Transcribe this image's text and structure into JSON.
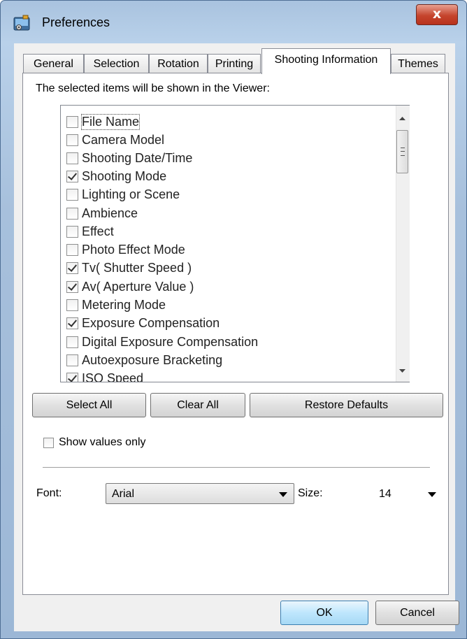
{
  "window": {
    "title": "Preferences",
    "close_glyph": "x",
    "app_icon": "preferences-app-icon",
    "close_icon": "close-icon"
  },
  "tabs": [
    {
      "label": "General"
    },
    {
      "label": "Selection"
    },
    {
      "label": "Rotation"
    },
    {
      "label": "Printing"
    },
    {
      "label": "Shooting Information",
      "active": true
    },
    {
      "label": "Themes"
    }
  ],
  "panel": {
    "instruction": "The selected items will be shown in the Viewer:",
    "items": [
      {
        "label": "File Name",
        "checked": false
      },
      {
        "label": "Camera Model",
        "checked": false
      },
      {
        "label": "Shooting Date/Time",
        "checked": false
      },
      {
        "label": "Shooting Mode",
        "checked": true
      },
      {
        "label": "Lighting or Scene",
        "checked": false
      },
      {
        "label": "Ambience",
        "checked": false
      },
      {
        "label": "Effect",
        "checked": false
      },
      {
        "label": "Photo Effect Mode",
        "checked": false
      },
      {
        "label": "Tv( Shutter Speed )",
        "checked": true
      },
      {
        "label": "Av( Aperture Value )",
        "checked": true
      },
      {
        "label": "Metering Mode",
        "checked": false
      },
      {
        "label": "Exposure Compensation",
        "checked": true
      },
      {
        "label": "Digital Exposure Compensation",
        "checked": false
      },
      {
        "label": "Autoexposure Bracketing",
        "checked": false
      },
      {
        "label": "ISO Speed",
        "checked": true
      }
    ],
    "buttons": {
      "select_all": "Select All",
      "clear_all": "Clear All",
      "restore_defaults": "Restore Defaults"
    },
    "show_values_only": {
      "label": "Show values only",
      "checked": false
    },
    "font": {
      "label": "Font:",
      "value": "Arial"
    },
    "size": {
      "label": "Size:",
      "value": "14"
    }
  },
  "footer": {
    "ok": "OK",
    "cancel": "Cancel"
  },
  "colors": {
    "title_bar": "#b9d1ea",
    "close_button": "#c5442d",
    "dialog_bg": "#f0f0f0",
    "default_button": "#bee6fd"
  }
}
